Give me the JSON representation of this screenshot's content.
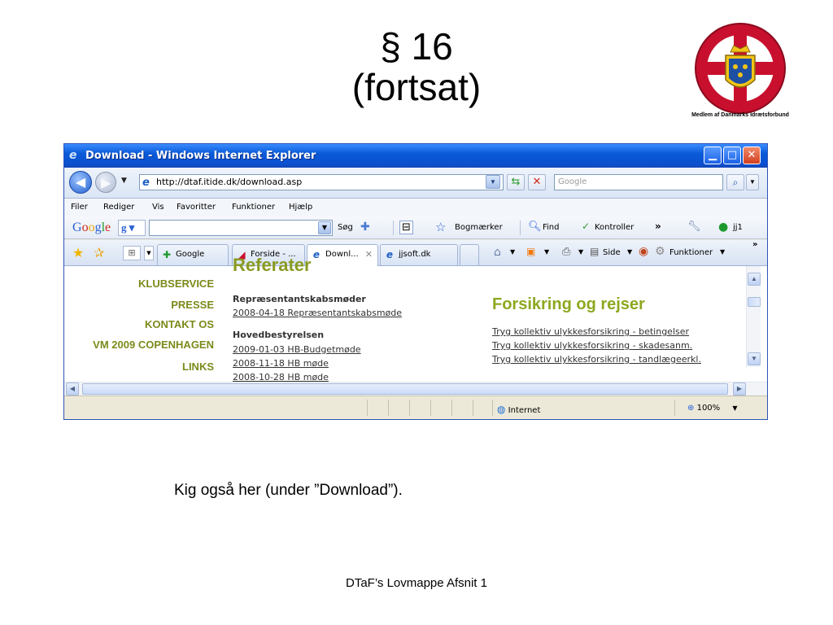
{
  "slide": {
    "title_line1": "§ 16",
    "title_line2": "(fortsat)",
    "caption": "Kig også her (under ”Download”).",
    "footer": "DTaF’s Lovmappe Afsnit 1",
    "logo": {
      "ring_text": "DANSK TAEKWONDO FORBUND",
      "caption": "Medlem af Danmarks Idrætsforbund"
    }
  },
  "ie": {
    "title": "Download - Windows Internet Explorer",
    "address": "http://dtaf.itide.dk/download.asp",
    "search_placeholder": "Google",
    "menu": [
      "Filer",
      "Rediger",
      "Vis",
      "Favoritter",
      "Funktioner",
      "Hjælp"
    ],
    "google_toolbar": {
      "logo": "Google",
      "search_button": "Søg",
      "bookmarks": "Bogmærker",
      "find": "Find",
      "check": "Kontroller",
      "more": "»",
      "user": "jj1"
    },
    "tabs": [
      {
        "label": "Google",
        "icon": "google-icon"
      },
      {
        "label": "Forside - ...",
        "icon": "page-icon"
      },
      {
        "label": "Downl...",
        "icon": "ie-icon",
        "active": true
      },
      {
        "label": "jjsoft.dk",
        "icon": "ie-icon"
      }
    ],
    "command_bar": {
      "page": "Side",
      "tools": "Funktioner",
      "more": "»"
    },
    "page": {
      "nav": [
        "KLUBSERVICE",
        "PRESSE",
        "KONTAKT OS",
        "VM 2009 COPENHAGEN",
        "LINKS"
      ],
      "cut_heading": "Referater",
      "sections": [
        {
          "heading": "Repræsentantskabsmøder",
          "links": [
            "2008-04-18 Repræsentantskabsmøde"
          ]
        },
        {
          "heading": "Hovedbestyrelsen",
          "links": [
            "2009-01-03 HB-Budgetmøde",
            "2008-11-18 HB møde",
            "2008-10-28 HB møde"
          ]
        }
      ],
      "right_title": "Forsikring og rejser",
      "right_links": [
        "Tryg kollektiv ulykkesforsikring - betingelser",
        "Tryg kollektiv ulykkesforsikring - skadesanm.",
        "Tryg kollektiv ulykkesforsikring - tandlægeerkl."
      ]
    },
    "status": {
      "zone": "Internet",
      "zoom": "100%"
    }
  },
  "colors": {
    "title_bar": "#0b4fcf",
    "nav_green": "#7c8a1a",
    "heading_green": "#8da81f"
  }
}
